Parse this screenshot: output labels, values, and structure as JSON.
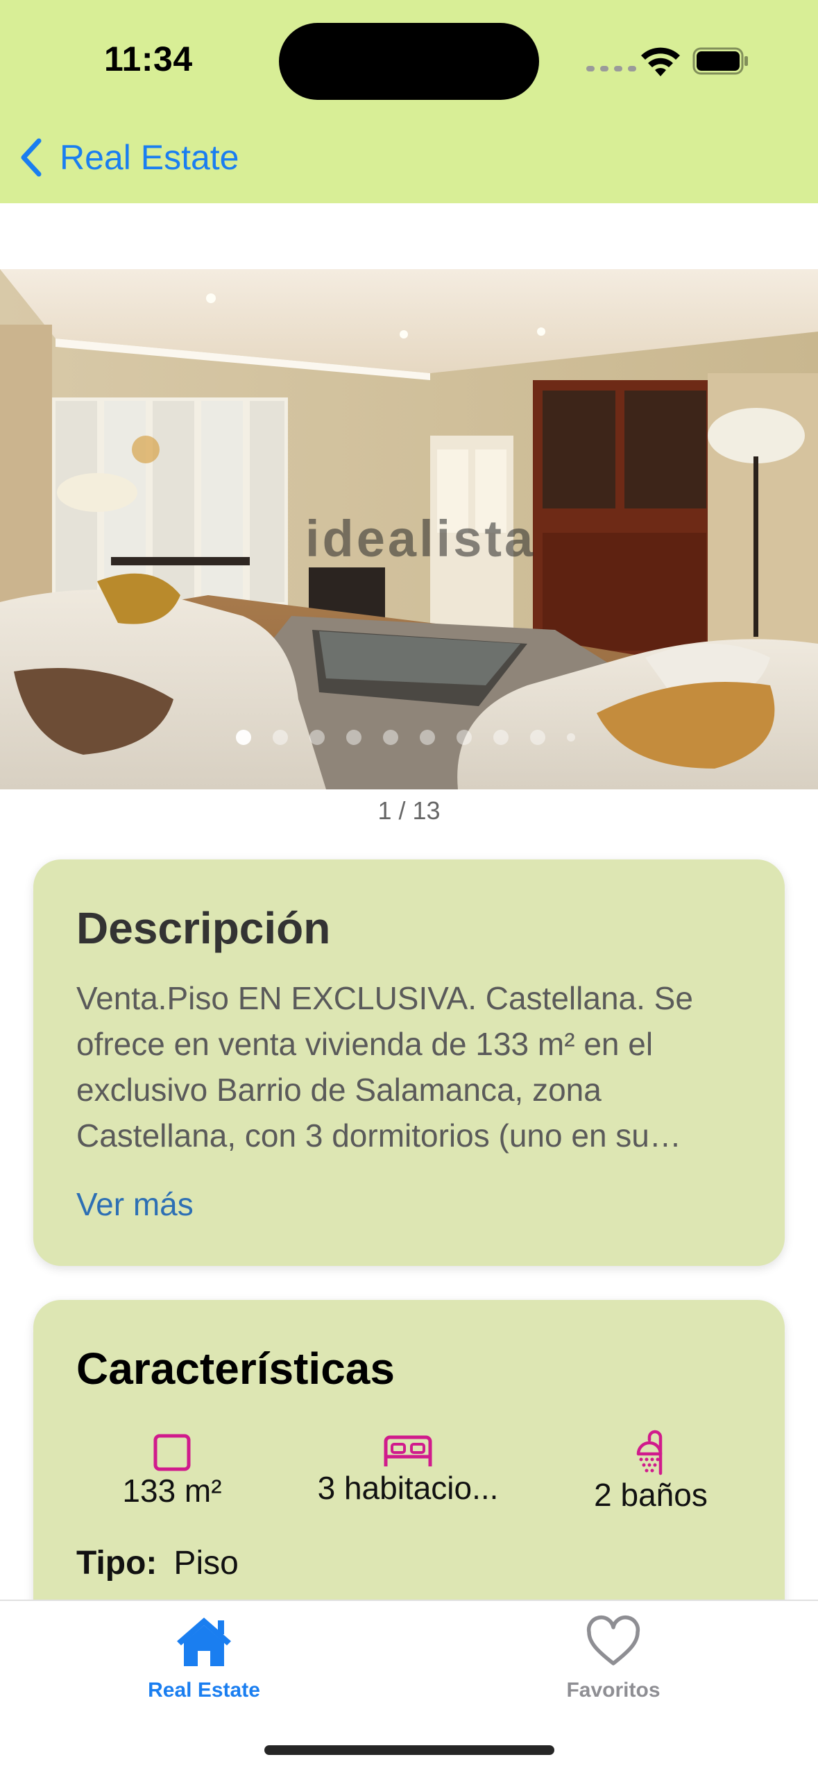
{
  "status_bar": {
    "time": "11:34"
  },
  "nav": {
    "back_label": "Real Estate"
  },
  "gallery": {
    "watermark": "idealista",
    "counter": "1 / 13",
    "current_index": 1,
    "total": 13,
    "visible_dots": 10
  },
  "description": {
    "title": "Descripción",
    "text": "Venta.Piso EN EXCLUSIVA. Castellana. Se ofrece en venta vivienda de 133 m² en el exclusivo Barrio de Salamanca, zona Castellana, con 3 dormitorios (uno en su…",
    "more_label": "Ver más"
  },
  "features": {
    "title": "Características",
    "area": "133 m²",
    "rooms": "3 habitacio...",
    "baths": "2 baños",
    "type_label": "Tipo:",
    "type_value": "Piso"
  },
  "tabs": [
    {
      "label": "Real Estate",
      "icon": "house-icon",
      "active": true
    },
    {
      "label": "Favoritos",
      "icon": "heart-icon",
      "active": false
    }
  ],
  "colors": {
    "header_bg": "#d8ee96",
    "card_bg": "#dde6b3",
    "accent_blue": "#1a7ef0",
    "feature_icon": "#d01b8c"
  }
}
